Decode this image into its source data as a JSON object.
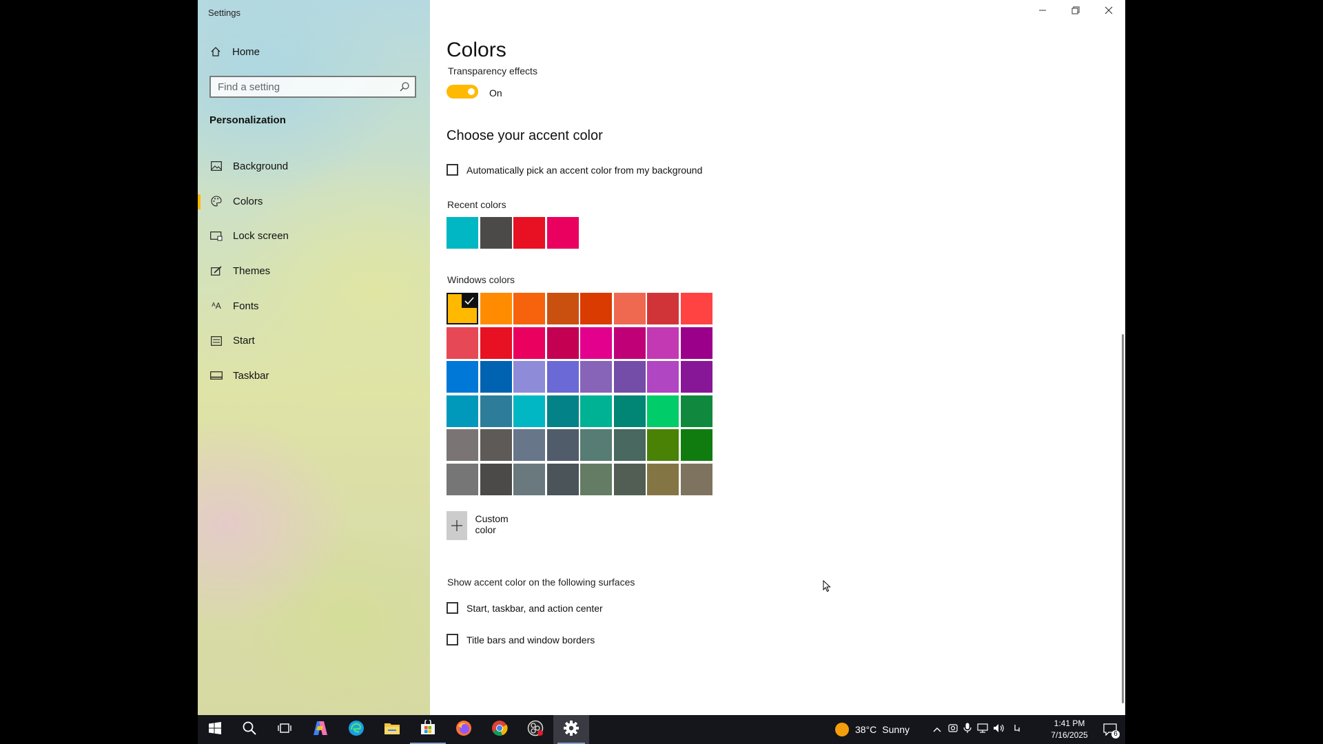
{
  "window": {
    "title": "Settings",
    "controls": [
      "minimize",
      "restore",
      "close"
    ]
  },
  "sidebar": {
    "home_label": "Home",
    "search_placeholder": "Find a setting",
    "section": "Personalization",
    "items": [
      {
        "label": "Background",
        "icon": "image-icon"
      },
      {
        "label": "Colors",
        "icon": "palette-icon",
        "active": true
      },
      {
        "label": "Lock screen",
        "icon": "lock-screen-icon"
      },
      {
        "label": "Themes",
        "icon": "brush-icon"
      },
      {
        "label": "Fonts",
        "icon": "fonts-icon"
      },
      {
        "label": "Start",
        "icon": "start-icon"
      },
      {
        "label": "Taskbar",
        "icon": "taskbar-icon"
      }
    ]
  },
  "main": {
    "title": "Colors",
    "transparency_label": "Transparency effects",
    "transparency_state": "On",
    "accent_heading": "Choose your accent color",
    "auto_pick_label": "Automatically pick an accent color from my background",
    "recent_label": "Recent colors",
    "recent_colors": [
      "#00b7c3",
      "#4c4a48",
      "#e81123",
      "#ea005e"
    ],
    "windows_label": "Windows colors",
    "windows_colors": [
      [
        "#ffb900",
        "#ff8c00",
        "#f7630c",
        "#ca5010",
        "#da3b01",
        "#ef6950",
        "#d13438",
        "#ff4343"
      ],
      [
        "#e74856",
        "#e81123",
        "#ea005e",
        "#c30052",
        "#e3008c",
        "#bf0077",
        "#c239b3",
        "#9a0089"
      ],
      [
        "#0078d7",
        "#0063b1",
        "#8e8cd8",
        "#6b69d6",
        "#8764b8",
        "#744da9",
        "#b146c2",
        "#881798"
      ],
      [
        "#0099bc",
        "#2d7d9a",
        "#00b7c3",
        "#038387",
        "#00b294",
        "#018574",
        "#00cc6a",
        "#10893e"
      ],
      [
        "#7a7574",
        "#5d5a58",
        "#68768a",
        "#515c6b",
        "#567c73",
        "#486860",
        "#498205",
        "#107c10"
      ],
      [
        "#767676",
        "#4c4a48",
        "#69797e",
        "#4a5459",
        "#647c64",
        "#525e54",
        "#847545",
        "#7e735f"
      ]
    ],
    "selected_color": "#ffb900",
    "custom_color_label": "Custom color",
    "surfaces_heading": "Show accent color on the following surfaces",
    "surface_options": [
      "Start, taskbar, and action center",
      "Title bars and window borders"
    ]
  },
  "taskbar": {
    "weather_temp": "38°C",
    "weather_desc": "Sunny",
    "time": "1:41 PM",
    "date": "7/16/2025",
    "notification_count": "6",
    "apps": [
      "start-icon",
      "search-icon",
      "task-view-icon",
      "copilot-icon",
      "edge-icon",
      "file-explorer-icon",
      "store-icon",
      "firefox-icon",
      "chrome-icon",
      "obs-icon",
      "settings-icon"
    ]
  }
}
